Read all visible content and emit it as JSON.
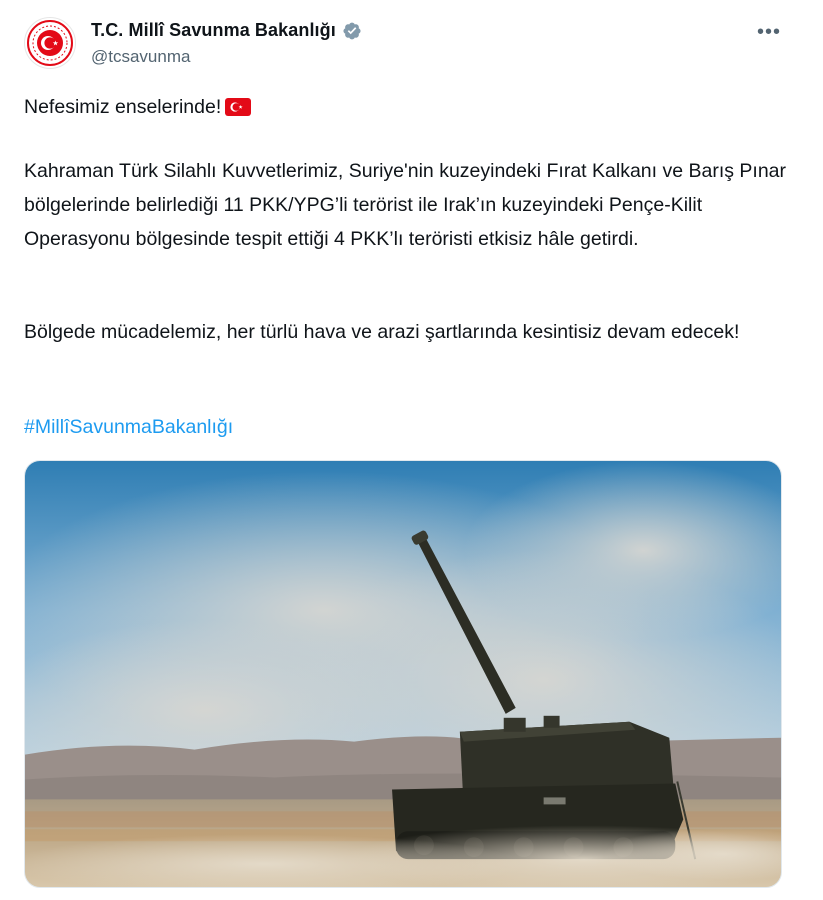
{
  "author": {
    "display_name": "T.C. Millî Savunma Bakanlığı",
    "handle": "@tcsavunma",
    "verified_icon": "verified-badge-icon",
    "avatar_icon": "ministry-emblem-icon"
  },
  "menu": {
    "more_icon": "more-options-icon",
    "more_glyph": "•••"
  },
  "tweet": {
    "line1": "Nefesimiz enselerinde!",
    "flag_icon": "turkey-flag-emoji",
    "paragraph2": "Kahraman Türk Silahlı Kuvvetlerimiz, Suriye'nin kuzeyindeki Fırat Kalkanı ve Barış Pınar bölgelerinde belirlediği 11 PKK/YPG’li terörist ile Irak’ın kuzeyindeki Pençe-Kilit Operasyonu bölgesinde tespit ettiği 4 PKK’lı teröristi etkisiz hâle getirdi.",
    "paragraph3": "Bölgede mücadelemiz, her türlü hava ve arazi şartlarında kesintisiz devam edecek!",
    "hashtag": "#MillîSavunmaBakanlığı"
  },
  "colors": {
    "text": "#0f1419",
    "secondary": "#536471",
    "link": "#1d9bf0",
    "verified": "#829aab",
    "emblem_red": "#e30a17"
  },
  "media": {
    "icon": "howitzer-photo"
  }
}
